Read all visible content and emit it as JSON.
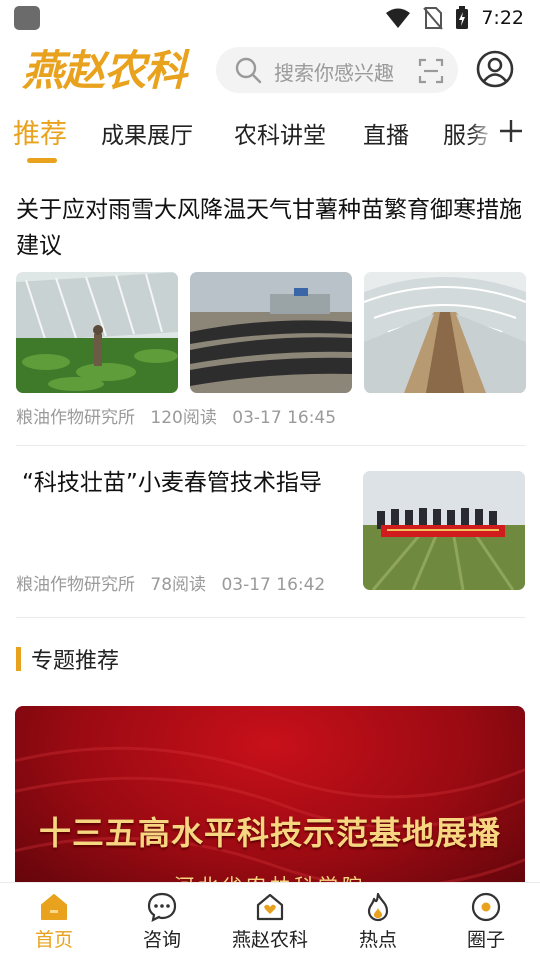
{
  "status_bar": {
    "time": "7:22"
  },
  "header": {
    "logo_text": "燕赵农科",
    "search": {
      "placeholder": "搜索你感兴趣"
    }
  },
  "tabs": [
    {
      "label": "推荐",
      "active": true
    },
    {
      "label": "成果展厅"
    },
    {
      "label": "农科讲堂"
    },
    {
      "label": "直播"
    },
    {
      "label": "服务"
    }
  ],
  "articles": [
    {
      "title": "关于应对雨雪大风降温天气甘薯种苗繁育御寒措施建议",
      "source": "粮油作物研究所",
      "reads": "120阅读",
      "time": "03-17 16:45"
    },
    {
      "title": "“科技壮苗”小麦春管技术指导",
      "source": "粮油作物研究所",
      "reads": "78阅读",
      "time": "03-17 16:42"
    }
  ],
  "section": {
    "title": "专题推荐"
  },
  "banner": {
    "title": "十三五高水平科技示范基地展播",
    "subtitle": "河北省农林科学院"
  },
  "bottom_nav": [
    {
      "label": "首页",
      "icon": "home-icon",
      "active": true
    },
    {
      "label": "咨询",
      "icon": "chat-icon"
    },
    {
      "label": "燕赵农科",
      "icon": "heart-house-icon"
    },
    {
      "label": "热点",
      "icon": "flame-icon"
    },
    {
      "label": "圈子",
      "icon": "circle-icon"
    }
  ],
  "colors": {
    "accent": "#e8a21e",
    "banner_red": "#a80c16"
  }
}
